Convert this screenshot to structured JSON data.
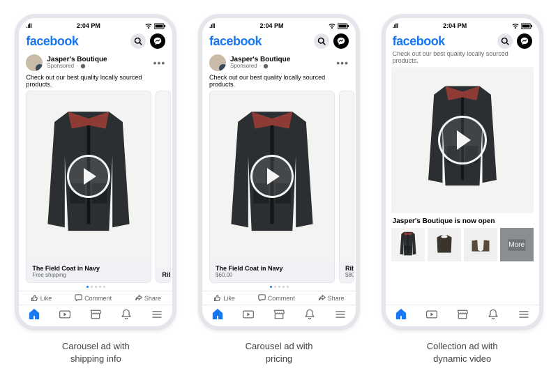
{
  "status": {
    "signal": ".ıll",
    "wifi": "wifi",
    "time": "2:04 PM",
    "battery": "bat"
  },
  "brand": "facebook",
  "post": {
    "advertiser": "Jasper's Boutique",
    "sponsored": "Sponsored",
    "caption": "Check out our best quality locally sourced products.",
    "caption_cut": "Check out our best quality locally sourced products."
  },
  "carousel": {
    "card1_title": "The Field Coat in Navy",
    "card1_sub_shipping": "Free shipping",
    "card1_sub_price": "$60.00",
    "peek_title": "Rib",
    "peek_sub": "$80"
  },
  "collection": {
    "headline": "Jasper's Boutique is now open",
    "more": "More"
  },
  "actions": {
    "like": "Like",
    "comment": "Comment",
    "share": "Share"
  },
  "captions": {
    "p1_l1": "Carousel ad with",
    "p1_l2": "shipping info",
    "p2_l1": "Carousel ad with",
    "p2_l2": "pricing",
    "p3_l1": "Collection ad with",
    "p3_l2": "dynamic video"
  }
}
